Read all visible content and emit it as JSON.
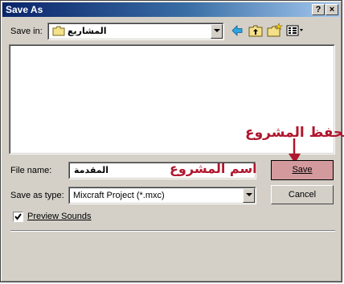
{
  "window": {
    "title": "Save As"
  },
  "titlebar": {
    "help_label": "?",
    "close_label": "×"
  },
  "savein": {
    "label": "Save in:",
    "value": "المشاريع",
    "icons": [
      "folder-icon",
      "back-arrow-icon",
      "up-folder-icon",
      "new-folder-icon",
      "view-menu-icon"
    ]
  },
  "filename": {
    "label": "File name:",
    "value": "المقدمة"
  },
  "savetype": {
    "label": "Save as type:",
    "value": "Mixcraft Project (*.mxc)"
  },
  "buttons": {
    "save": "Save",
    "cancel": "Cancel"
  },
  "preview": {
    "label": "Preview Sounds",
    "checked": true
  },
  "annotations": {
    "save_project": "لحفظ المشروع",
    "project_name": "اسم المشروع"
  },
  "colors": {
    "annotation": "#b0162e",
    "titlebar_start": "#0a246a",
    "titlebar_end": "#a6caf0",
    "dialog_bg": "#d4d0c8"
  }
}
